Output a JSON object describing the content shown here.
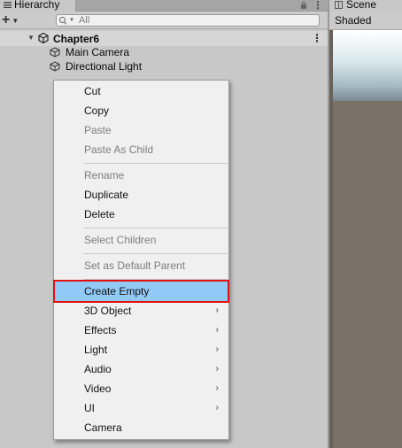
{
  "hierarchy": {
    "tab_title": "Hierarchy",
    "search_placeholder": "All",
    "kebab": "⋮",
    "scene": {
      "name": "Chapter6",
      "menu": "⋮"
    },
    "objects": [
      {
        "name": "Main Camera"
      },
      {
        "name": "Directional Light"
      }
    ]
  },
  "scene_panel": {
    "tab_title": "Scene",
    "shading_mode": "Shaded"
  },
  "context_menu": {
    "items": [
      {
        "label": "Cut",
        "enabled": true
      },
      {
        "label": "Copy",
        "enabled": true
      },
      {
        "label": "Paste",
        "enabled": false
      },
      {
        "label": "Paste As Child",
        "enabled": false
      },
      {
        "label": "Rename",
        "enabled": false
      },
      {
        "label": "Duplicate",
        "enabled": true
      },
      {
        "label": "Delete",
        "enabled": true
      },
      {
        "label": "Select Children",
        "enabled": false
      },
      {
        "label": "Set as Default Parent",
        "enabled": false
      },
      {
        "label": "Create Empty",
        "enabled": true,
        "highlighted": true
      },
      {
        "label": "3D Object",
        "enabled": true,
        "submenu": true
      },
      {
        "label": "Effects",
        "enabled": true,
        "submenu": true
      },
      {
        "label": "Light",
        "enabled": true,
        "submenu": true
      },
      {
        "label": "Audio",
        "enabled": true,
        "submenu": true
      },
      {
        "label": "Video",
        "enabled": true,
        "submenu": true
      },
      {
        "label": "UI",
        "enabled": true,
        "submenu": true
      },
      {
        "label": "Camera",
        "enabled": true
      }
    ],
    "submenu_arrow": "›"
  },
  "colors": {
    "highlight": "#91c9f7",
    "highlight_border": "#e01010",
    "scene_bg": "#797066"
  }
}
